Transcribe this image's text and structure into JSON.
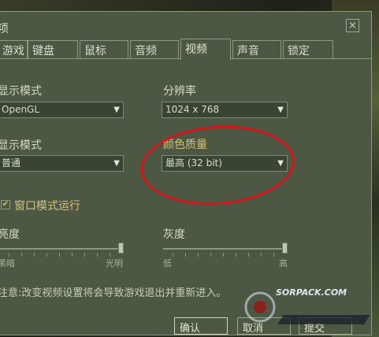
{
  "dialog": {
    "title": "项",
    "close": "×"
  },
  "tabs": [
    {
      "label": "游戏"
    },
    {
      "label": "键盘"
    },
    {
      "label": "鼠标"
    },
    {
      "label": "音频"
    },
    {
      "label": "视频"
    },
    {
      "label": "声音"
    },
    {
      "label": "锁定"
    }
  ],
  "video": {
    "display_mode_label": "显示模式",
    "display_mode_value": "OpenGL",
    "resolution_label": "分辨率",
    "resolution_value": "1024 x 768",
    "display_mode2_label": "显示模式",
    "display_mode2_value": "普通",
    "color_quality_label": "颜色质量",
    "color_quality_value": "最高 (32 bit)",
    "windowed_label": "窗口模式运行",
    "brightness_label": "亮度",
    "brightness_min": "黑暗",
    "brightness_max": "光明",
    "brightness_level": 1.0,
    "gamma_label": "灰度",
    "gamma_min": "低",
    "gamma_max": "高",
    "gamma_level": 1.0,
    "note": "注意:改变视频设置将会导致游戏退出并重新进入。"
  },
  "buttons": {
    "ok": "确认",
    "cancel": "取消",
    "apply": "提交"
  },
  "watermark": {
    "text": "SORPACK.COM"
  },
  "colors": {
    "annotation": "#d8141a",
    "highlight_label": "#d4c27a"
  }
}
